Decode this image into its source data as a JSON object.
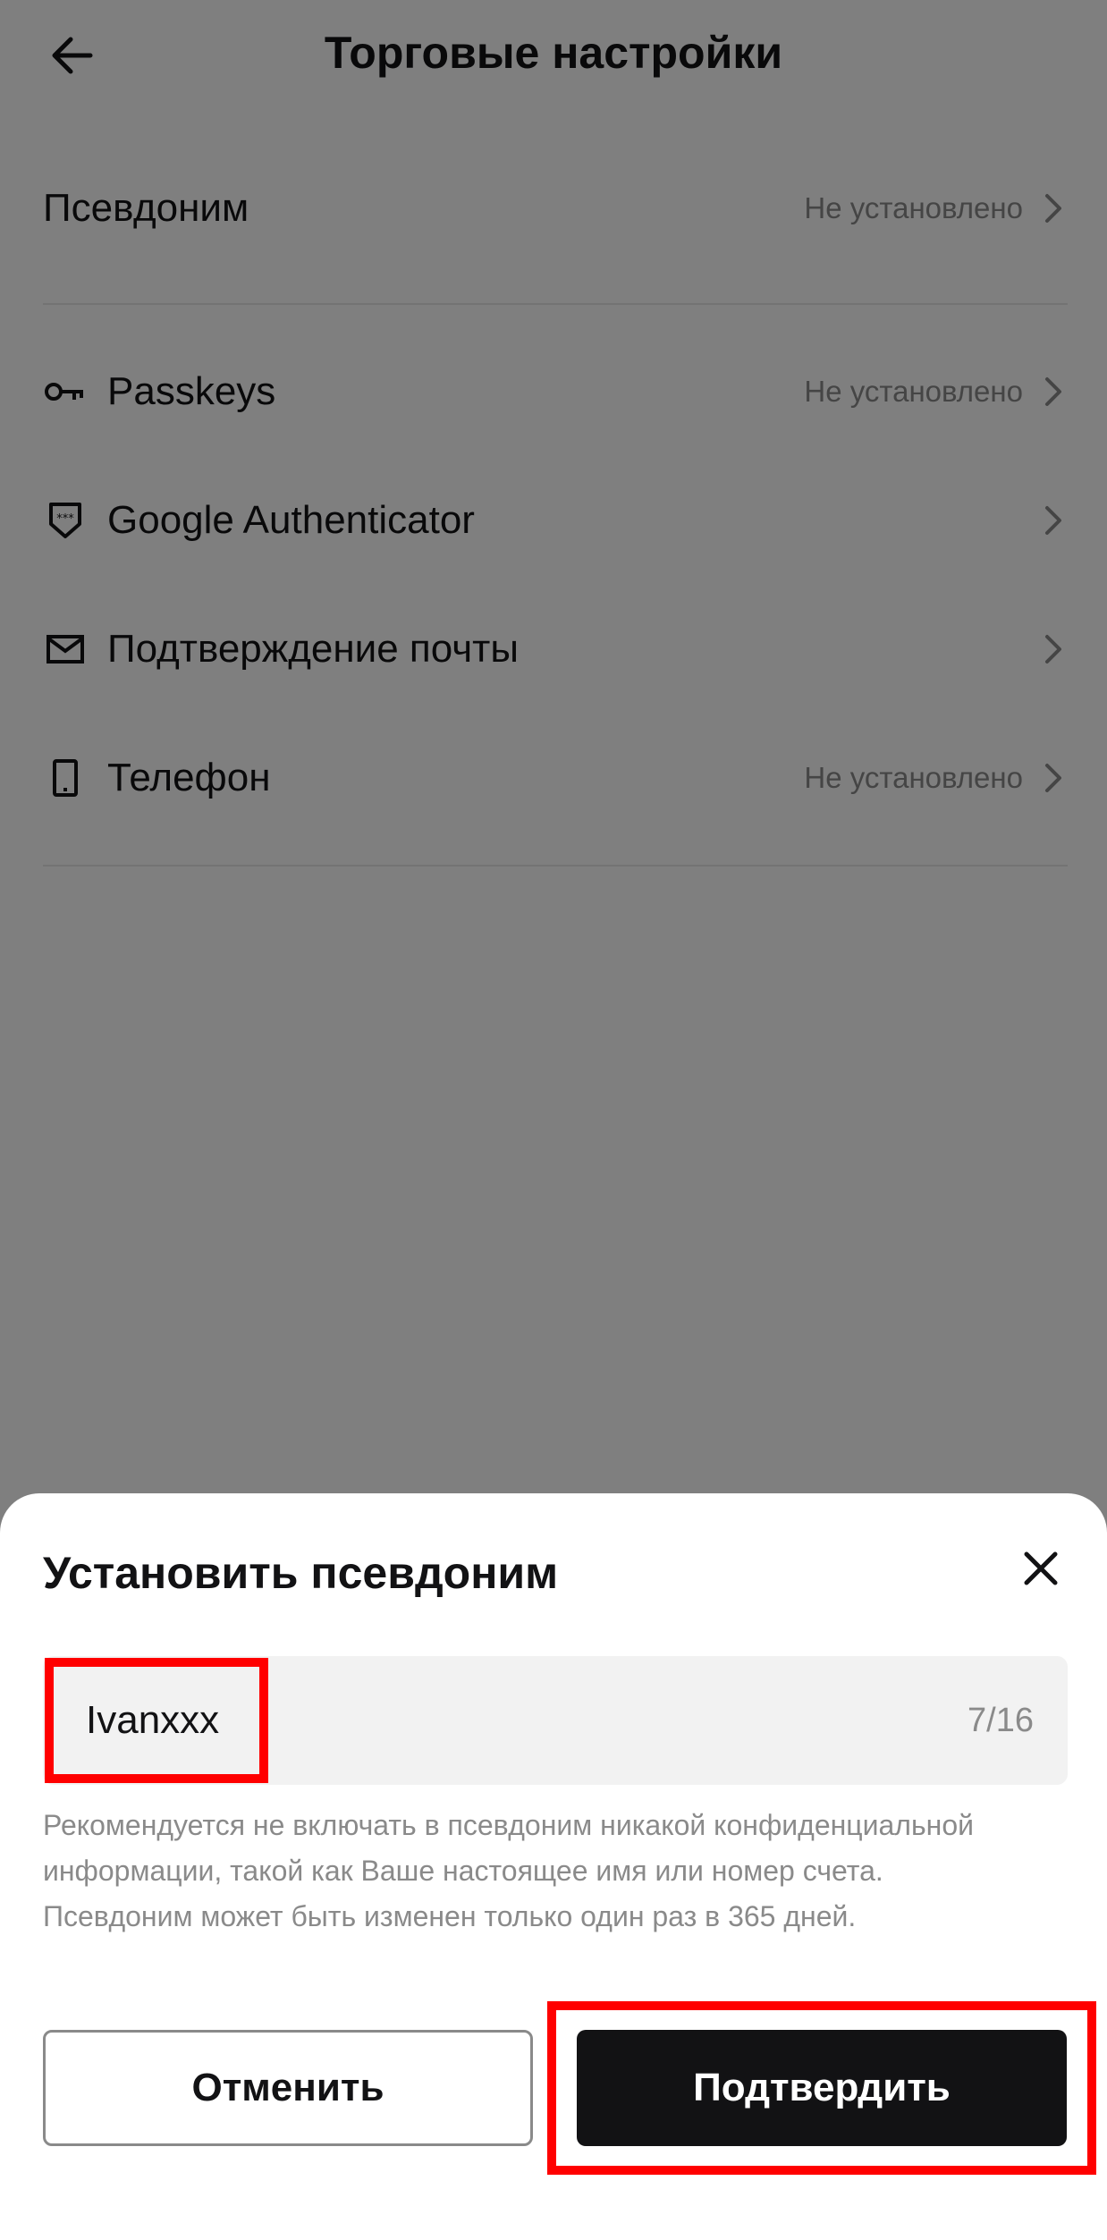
{
  "header": {
    "title": "Торговые настройки",
    "back_icon": "arrow-left-icon"
  },
  "settings": {
    "nickname": {
      "label": "Псевдоним",
      "value": "Не установлено"
    },
    "security_items": [
      {
        "label": "Passkeys",
        "value": "Не установлено",
        "icon": "key-icon"
      },
      {
        "label": "Google Authenticator",
        "value": "",
        "icon": "shield-icon"
      },
      {
        "label": "Подтверждение почты",
        "value": "",
        "icon": "mail-icon"
      },
      {
        "label": "Телефон",
        "value": "Не установлено",
        "icon": "phone-icon"
      }
    ]
  },
  "dialog": {
    "title": "Установить псевдоним",
    "input": {
      "value": "Ivanxxx",
      "counter": "7/16"
    },
    "hint_lines": [
      "Рекомендуется не включать в псевдоним никакой конфиденциальной",
      "информации, такой как Ваше настоящее имя или номер счета.",
      "Псевдоним может быть изменен только один раз в 365 дней."
    ],
    "cancel_label": "Отменить",
    "confirm_label": "Подтвердить"
  },
  "colors": {
    "text_primary": "#121214",
    "text_secondary": "#8a8a8a",
    "confirm_bg": "#121214",
    "highlight": "#ff0000",
    "overlay": "rgba(0,0,0,0.5)"
  }
}
